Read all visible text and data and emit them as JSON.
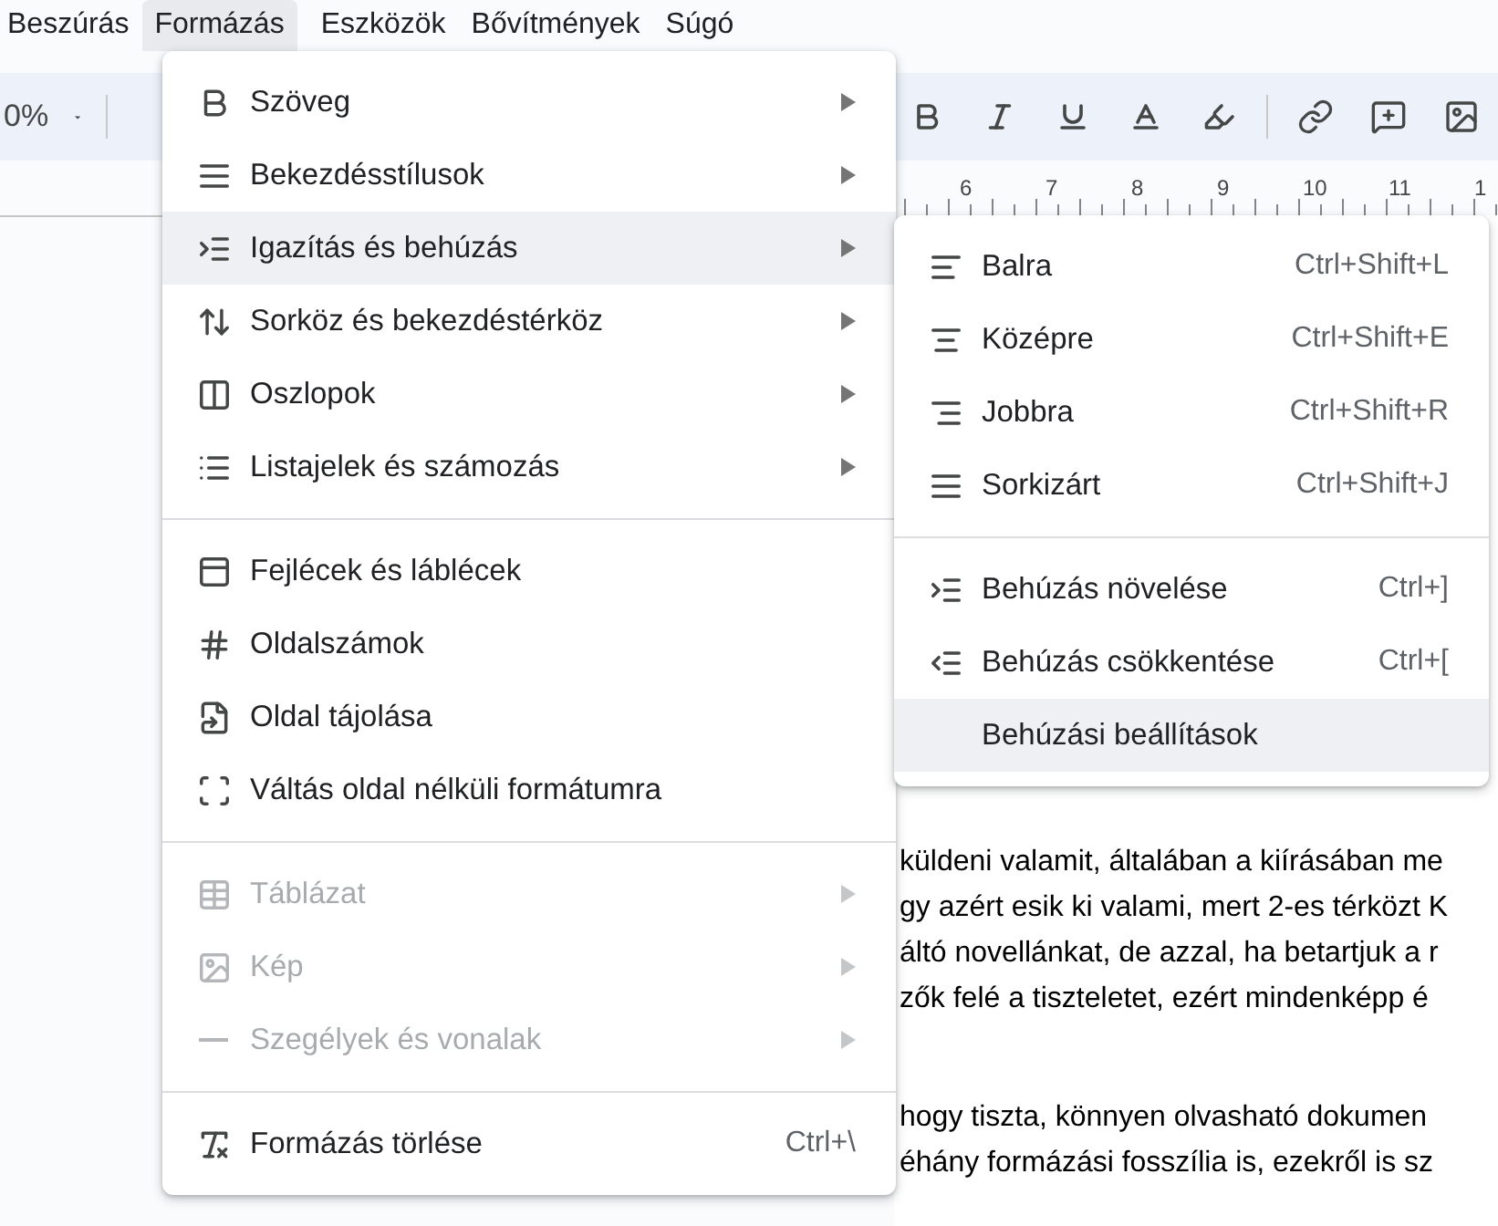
{
  "menubar": [
    {
      "label": "Beszúrás",
      "selected": false
    },
    {
      "label": "Formázás",
      "selected": true
    },
    {
      "label": "Eszközök",
      "selected": false
    },
    {
      "label": "Bővítmények",
      "selected": false
    },
    {
      "label": "Súgó",
      "selected": false
    }
  ],
  "toolbar": {
    "zoom": "0%"
  },
  "ruler": [
    "6",
    "7",
    "8",
    "9",
    "10",
    "11",
    "1"
  ],
  "document": {
    "paragraphs": [
      [
        "küldeni valamit, általában a kiírásában me",
        "gy azért esik ki valami, mert 2-es térközt K",
        "áltó novellánkat, de azzal, ha betartjuk a r",
        "zők felé a tiszteletet, ezért mindenképp é"
      ],
      [
        "hogy tiszta, könnyen olvasható dokumen",
        "éhány formázási fosszília is, ezekről is sz"
      ]
    ]
  },
  "format_menu": {
    "sections": [
      [
        {
          "label": "Szöveg",
          "submenu": true,
          "selected": false,
          "disabled": false
        },
        {
          "label": "Bekezdésstílusok",
          "submenu": true,
          "selected": false,
          "disabled": false
        },
        {
          "label": "Igazítás és behúzás",
          "submenu": true,
          "selected": true,
          "disabled": false
        },
        {
          "label": "Sorköz és bekezdéstérköz",
          "submenu": true,
          "selected": false,
          "disabled": false
        },
        {
          "label": "Oszlopok",
          "submenu": true,
          "selected": false,
          "disabled": false
        },
        {
          "label": "Listajelek és számozás",
          "submenu": true,
          "selected": false,
          "disabled": false
        }
      ],
      [
        {
          "label": "Fejlécek és láblécek",
          "submenu": false,
          "selected": false,
          "disabled": false
        },
        {
          "label": "Oldalszámok",
          "submenu": false,
          "selected": false,
          "disabled": false
        },
        {
          "label": "Oldal tájolása",
          "submenu": false,
          "selected": false,
          "disabled": false
        },
        {
          "label": "Váltás oldal nélküli formátumra",
          "submenu": false,
          "selected": false,
          "disabled": false
        }
      ],
      [
        {
          "label": "Táblázat",
          "submenu": true,
          "selected": false,
          "disabled": true
        },
        {
          "label": "Kép",
          "submenu": true,
          "selected": false,
          "disabled": true
        },
        {
          "label": "Szegélyek és vonalak",
          "submenu": true,
          "selected": false,
          "disabled": true
        }
      ],
      [
        {
          "label": "Formázás törlése",
          "shortcut": "Ctrl+\\",
          "submenu": false,
          "selected": false,
          "disabled": false
        }
      ]
    ]
  },
  "align_submenu": {
    "sections": [
      [
        {
          "label": "Balra",
          "shortcut": "Ctrl+Shift+L",
          "selected": false
        },
        {
          "label": "Középre",
          "shortcut": "Ctrl+Shift+E",
          "selected": false
        },
        {
          "label": "Jobbra",
          "shortcut": "Ctrl+Shift+R",
          "selected": false
        },
        {
          "label": "Sorkizárt",
          "shortcut": "Ctrl+Shift+J",
          "selected": false
        }
      ],
      [
        {
          "label": "Behúzás növelése",
          "shortcut": "Ctrl+]",
          "selected": false
        },
        {
          "label": "Behúzás csökkentése",
          "shortcut": "Ctrl+[",
          "selected": false
        },
        {
          "label": "Behúzási beállítások",
          "selected": true
        }
      ]
    ]
  }
}
